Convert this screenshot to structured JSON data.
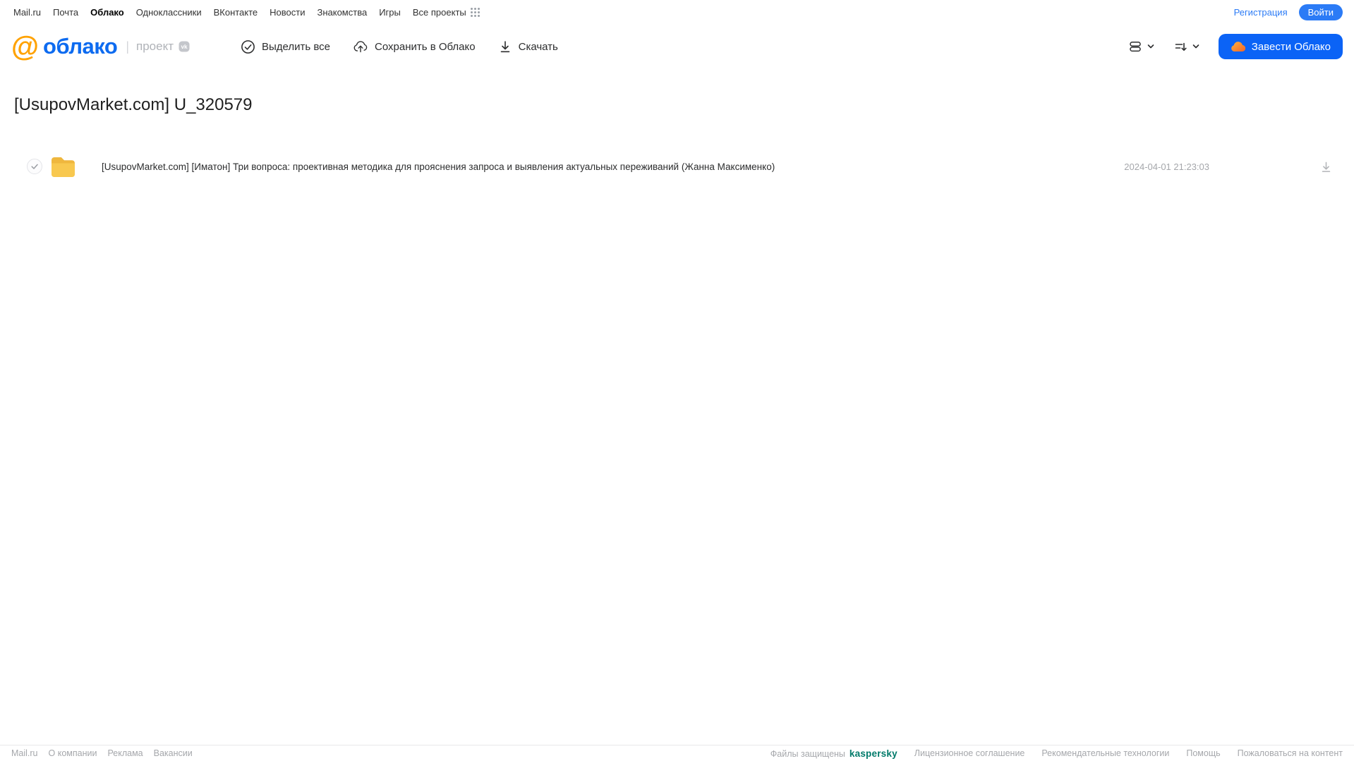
{
  "topnav": {
    "items": [
      "Mail.ru",
      "Почта",
      "Облако",
      "Одноклассники",
      "ВКонтакте",
      "Новости",
      "Знакомства",
      "Игры",
      "Все проекты"
    ],
    "active_item": "Облако",
    "registration": "Регистрация",
    "login": "Войти"
  },
  "header": {
    "logo_at": "@",
    "logo_text": "облако",
    "project_label": "проект",
    "toolbar": [
      {
        "label": "Выделить все",
        "icon": "check-circle-icon"
      },
      {
        "label": "Сохранить в Облако",
        "icon": "cloud-upload-icon"
      },
      {
        "label": "Скачать",
        "icon": "download-icon"
      }
    ],
    "view_control_icon": "view-mode-icon",
    "sort_control_icon": "sort-icon",
    "create_cloud_label": "Завести Облако"
  },
  "main": {
    "title": "[UsupovMarket.com] U_320579",
    "files": [
      {
        "type": "folder",
        "name": "[UsupovMarket.com] [Иматон] Три вопроса: проективная методика для прояснения запроса и выявления актуальных переживаний (Жанна Максименко)",
        "date": "2024-04-01 21:23:03"
      }
    ]
  },
  "footer": {
    "left_links": [
      "Mail.ru",
      "О компании",
      "Реклама",
      "Вакансии"
    ],
    "protected_label": "Файлы защищены",
    "kaspersky_brand": "kaspersky",
    "right_links": [
      "Лицензионное соглашение",
      "Рекомендательные технологии",
      "Помощь",
      "Пожаловаться на контент"
    ]
  },
  "colors": {
    "accent_blue": "#0b63f6",
    "logo_blue": "#0d6bf0",
    "logo_orange": "#ffa200",
    "folder_yellow": "#f8c84f",
    "folder_dark": "#efb73e",
    "kaspersky_green": "#007a6a",
    "text_dark": "#2c2d2e",
    "text_gray": "#a5a7ab"
  }
}
